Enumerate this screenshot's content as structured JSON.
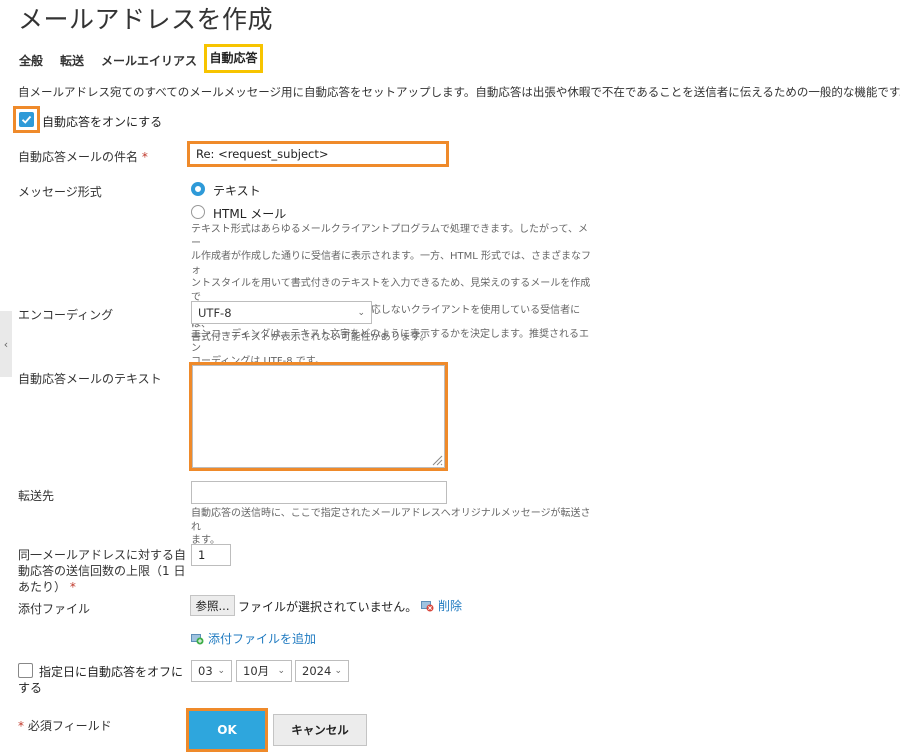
{
  "page": {
    "title": "メールアドレスを作成"
  },
  "tabs": [
    {
      "label": "全般"
    },
    {
      "label": "転送"
    },
    {
      "label": "メールエイリアス"
    },
    {
      "label": "自動応答"
    }
  ],
  "description": "自メールアドレス宛てのすべてのメールメッセージ用に自動応答をセットアップします。自動応答は出張や休暇で不在であることを送信者に伝えるための一般的な機能です。",
  "autoreply_toggle": {
    "label": "自動応答をオンにする",
    "checked": true
  },
  "subject": {
    "label": "自動応答メールの件名",
    "required_mark": "*",
    "value": "Re: <request_subject>"
  },
  "format": {
    "label": "メッセージ形式",
    "options": [
      {
        "label": "テキスト",
        "selected": true
      },
      {
        "label": "HTML メール",
        "selected": false
      }
    ],
    "hint_lines": [
      "テキスト形式はあらゆるメールクライアントプログラムで処理できます。したがって、メー",
      "ル作成者が作成した通りに受信者に表示されます。一方、HTML 形式では、さまざまなフォ",
      "ントスタイルを用いて書式付きのテキストを入力できるため、見栄えのするメールを作成で",
      "きます。ただし、HTML メッセージに対応しないクライアントを使用している受信者には、",
      "書式付きテキストが表示されない可能性があります。"
    ]
  },
  "encoding": {
    "label": "エンコーディング",
    "value": "UTF-8",
    "hint_lines": [
      "エンコーディングは、テキスト文字をどのように表示するかを決定します。推奨されるエン",
      "コーディングは UTF-8 です。"
    ]
  },
  "body_text": {
    "label": "自動応答メールのテキスト",
    "value": ""
  },
  "forward": {
    "label": "転送先",
    "value": "",
    "hint_lines": [
      "自動応答の送信時に、ここで指定されたメールアドレスへオリジナルメッセージが転送され",
      "ます。"
    ]
  },
  "limit": {
    "label_lines": [
      "同一メールアドレスに対する自",
      "動応答の送信回数の上限（1 日",
      "あたり）"
    ],
    "required_mark": "*",
    "value": "1"
  },
  "attachment": {
    "label": "添付ファイル",
    "browse_label": "参照...",
    "status": "ファイルが選択されていません。",
    "delete_label": "削除",
    "add_label": "添付ファイルを追加"
  },
  "end_date": {
    "label_lines": [
      "指定日に自動応答をオフに",
      "する"
    ],
    "checked": false,
    "day": "03",
    "month": "10月",
    "year": "2024"
  },
  "footer": {
    "required_note": "必須フィールド",
    "required_mark": "*",
    "ok_label": "OK",
    "cancel_label": "キャンセル"
  },
  "colors": {
    "accent": "#2e9ad8",
    "highlight_orange": "#ef8a2a",
    "highlight_yellow": "#f7c400"
  }
}
